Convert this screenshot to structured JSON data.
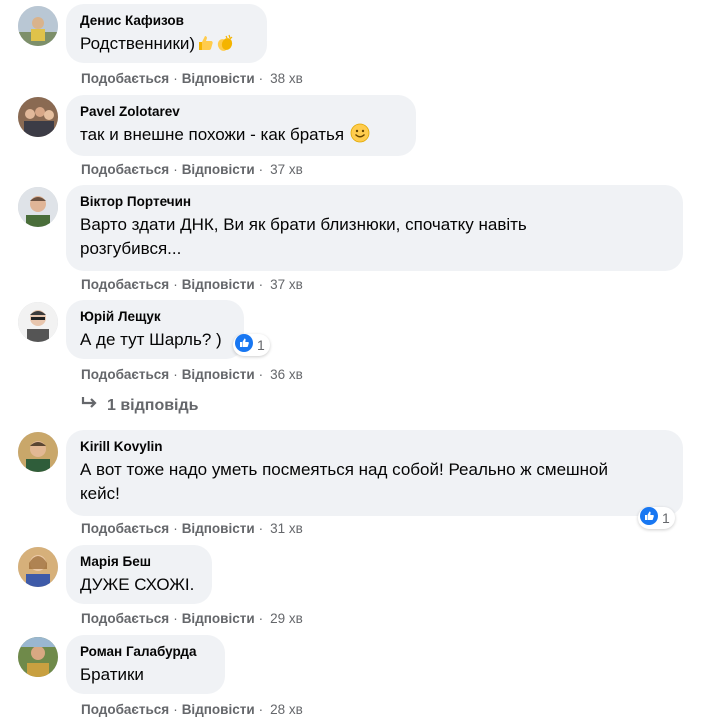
{
  "actions": {
    "like": "Подобається",
    "reply": "Відповісти",
    "separator": "·"
  },
  "colors": {
    "like_blue": "#1877f2",
    "bubble_bg": "#f0f2f5",
    "meta_gray": "#65676b"
  },
  "comments": [
    {
      "author": "Денис Кафизов",
      "text": "Родственники)",
      "emoji": [
        "thumbs-up-emoji",
        "clapping-hands-emoji"
      ],
      "time": "38 хв"
    },
    {
      "author": "Pavel Zolotarev",
      "text": "так и внешне похожи - как братья ",
      "emoji": [
        "smiling-face-emoji"
      ],
      "time": "37 хв"
    },
    {
      "author": "Віктор Портечин",
      "text_line1": "Варто здати ДНК, Ви як брати близнюки, спочатку навіть",
      "text_line2": "розгубився...",
      "time": "37 хв"
    },
    {
      "author": "Юрій Лещук",
      "text": "А де тут Шарль? )",
      "reactions": "1",
      "time": "36 хв"
    },
    {
      "author": "Kirill Kovylin",
      "text_line1": "А вот тоже надо уметь посмеяться над собой! Реально ж смешной",
      "text_line2": "кейс!",
      "reactions": "1",
      "time": "31 хв"
    },
    {
      "author": "Марія Беш",
      "text": "ДУЖЕ СХОЖІ.",
      "time": "29 хв"
    },
    {
      "author": "Роман Галабурда",
      "text": "Братики",
      "time": "28 хв"
    }
  ],
  "replies_link": "1 відповідь"
}
